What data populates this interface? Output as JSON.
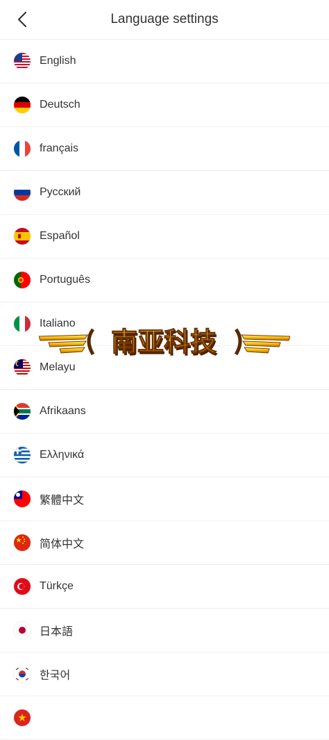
{
  "header": {
    "title": "Language settings"
  },
  "languages": [
    {
      "label": "English",
      "flag": "us-flag-icon"
    },
    {
      "label": "Deutsch",
      "flag": "germany-flag-icon"
    },
    {
      "label": "français",
      "flag": "france-flag-icon"
    },
    {
      "label": "Русский",
      "flag": "russia-flag-icon"
    },
    {
      "label": "Español",
      "flag": "spain-flag-icon"
    },
    {
      "label": "Português",
      "flag": "portugal-flag-icon"
    },
    {
      "label": "Italiano",
      "flag": "italy-flag-icon"
    },
    {
      "label": "Melayu",
      "flag": "malaysia-flag-icon"
    },
    {
      "label": "Afrikaans",
      "flag": "south-africa-flag-icon"
    },
    {
      "label": "Ελληνικά",
      "flag": "greece-flag-icon"
    },
    {
      "label": "繁體中文",
      "flag": "taiwan-flag-icon"
    },
    {
      "label": "简体中文",
      "flag": "china-flag-icon"
    },
    {
      "label": "Türkçe",
      "flag": "turkey-flag-icon"
    },
    {
      "label": "日本語",
      "flag": "japan-flag-icon"
    },
    {
      "label": "한국어",
      "flag": "korea-flag-icon"
    },
    {
      "label": "",
      "flag": "vietnam-flag-icon"
    }
  ],
  "watermark": {
    "text": "南亚科技"
  },
  "colors": {
    "divider": "#efefef",
    "text": "#333333",
    "watermark_gold": "#f5b800"
  }
}
